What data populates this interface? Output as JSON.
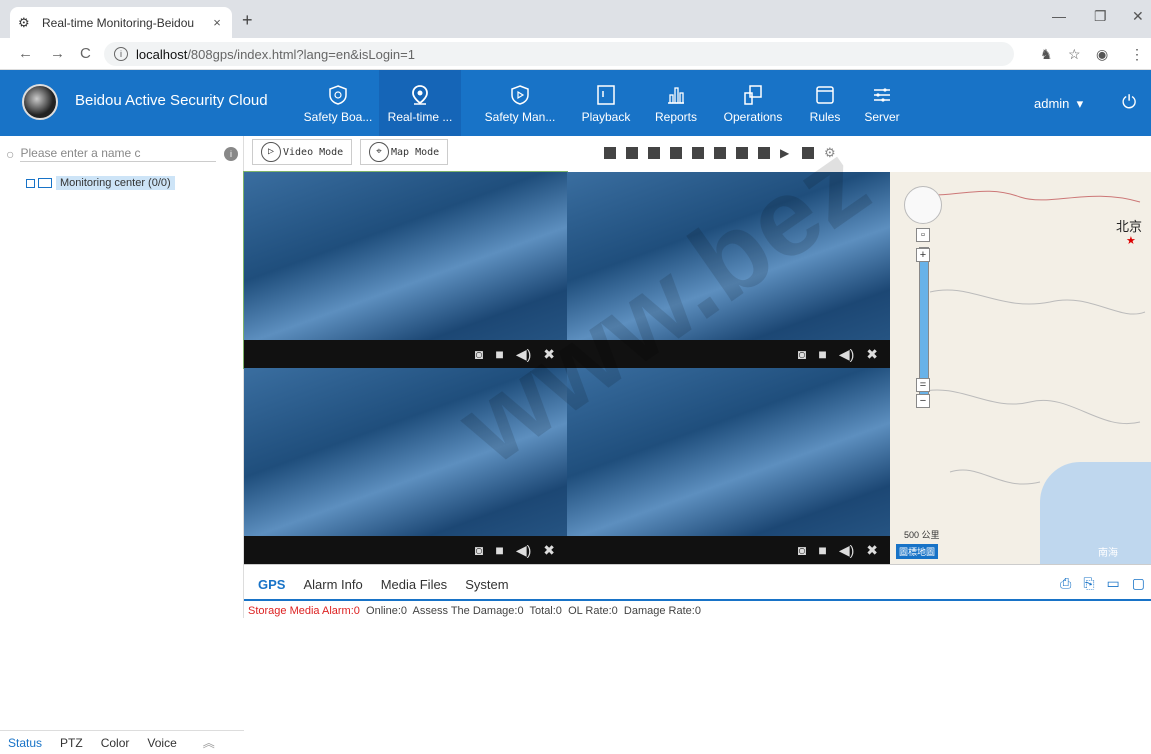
{
  "browser": {
    "tab_title": "Real-time Monitoring-Beidou",
    "url_host": "localhost",
    "url_path": "/808gps/index.html?lang=en&isLogin=1"
  },
  "header": {
    "brand": "Beidou Active Security Cloud",
    "nav": [
      {
        "label": "Safety Boa...",
        "icon": "shield-icon"
      },
      {
        "label": "Real-time ...",
        "icon": "location-pin-icon"
      },
      {
        "label": "Safety Man...",
        "icon": "shield-play-icon"
      },
      {
        "label": "Playback",
        "icon": "playback-icon"
      },
      {
        "label": "Reports",
        "icon": "bar-chart-icon"
      },
      {
        "label": "Operations",
        "icon": "operations-icon"
      },
      {
        "label": "Rules",
        "icon": "window-icon"
      },
      {
        "label": "Server",
        "icon": "sliders-icon"
      }
    ],
    "user": "admin"
  },
  "left": {
    "search_placeholder": "Please enter a name c",
    "tree_root": "Monitoring center (0/0)",
    "bottom_tabs": [
      "Status",
      "PTZ",
      "Color",
      "Voice"
    ]
  },
  "toolbar": {
    "video_mode": "Video Mode",
    "map_mode": "Map Mode"
  },
  "map": {
    "capital": "北京",
    "scale": "500 公里",
    "sea": "南海",
    "logo": "圖標地圖"
  },
  "status": {
    "tabs": [
      "GPS",
      "Alarm Info",
      "Media Files",
      "System"
    ],
    "storage_alarm": "Storage Media Alarm:0",
    "online": "Online:0",
    "assess": "Assess The Damage:0",
    "total": "Total:0",
    "ol_rate": "OL Rate:0",
    "damage_rate": "Damage Rate:0"
  },
  "watermark": "www.bez",
  "colors": {
    "primary": "#1873c7",
    "alarm": "#d22222"
  }
}
